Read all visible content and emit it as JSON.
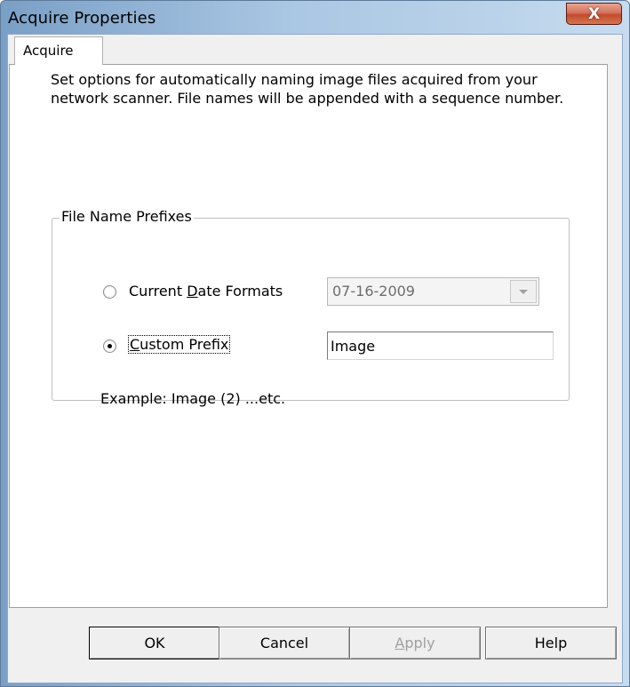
{
  "window": {
    "title": "Acquire Properties",
    "close_glyph": "X"
  },
  "tabs": [
    {
      "label": "Acquire",
      "selected": true
    }
  ],
  "description": "Set options for automatically naming image files acquired from your network scanner. File names will be appended with a sequence number.",
  "group": {
    "label": "File Name Prefixes",
    "options": [
      {
        "label_pre": "Current ",
        "mnemonic": "D",
        "label_post": "ate Formats",
        "selected": false
      },
      {
        "label_pre": "",
        "mnemonic": "C",
        "label_post": "ustom Prefix",
        "selected": true
      }
    ],
    "date_format": {
      "value": "07-16-2009",
      "enabled": false
    },
    "custom_prefix": {
      "value": "Image"
    },
    "example": "Example: Image (2) ...etc."
  },
  "buttons": {
    "ok": "OK",
    "cancel": "Cancel",
    "apply_mnemonic": "A",
    "apply_rest": "pply",
    "help": "Help"
  },
  "icons": {
    "close": "close-icon",
    "dropdown": "chevron-down-icon"
  }
}
